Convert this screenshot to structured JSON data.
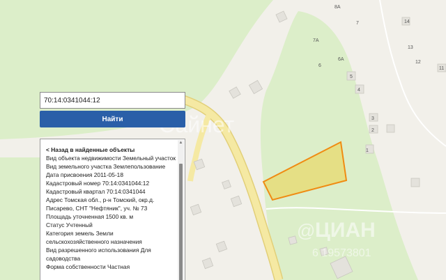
{
  "map": {
    "house_numbers": [
      "8А",
      "7",
      "14",
      "7А",
      "6А",
      "13",
      "12",
      "11",
      "6",
      "5",
      "4",
      "3",
      "2",
      "1"
    ],
    "watermark": {
      "cian_text": "ЦИАН",
      "cian_prefix": "@",
      "phone_fragment": "6 19573801",
      "top_text": "Сайнет"
    },
    "colors": {
      "forest": "#dceec9",
      "background": "#f2f0ea",
      "road": "#f5e9a3",
      "road_edge": "#e2cf78",
      "building": "#e4e2dc",
      "parcel_fill": "#e8da6e",
      "parcel_stroke": "#f08b12"
    }
  },
  "search": {
    "value": "70:14:0341044:12",
    "button_label": "Найти"
  },
  "details": {
    "back_link": "< Назад в найденные объекты",
    "lines": [
      "Вид объекта недвижимости Земельный участок",
      "Вид земельного участка Землепользование",
      "Дата присвоения 2011-05-18",
      "Кадастровый номер 70:14:0341044:12",
      "Кадастровый квартал 70:14:0341044",
      "Адрес Томская обл., р-н Томский, окр.д. Писарево, СНТ \"Нефтяник\", уч. № 73",
      "Площадь уточненная 1500 кв. м",
      "Статус Учтенный",
      "Категория земель Земли сельскохозяйственного назначения",
      "Вид разрешенного использования Для садоводства",
      "Форма собственности Частная"
    ]
  }
}
